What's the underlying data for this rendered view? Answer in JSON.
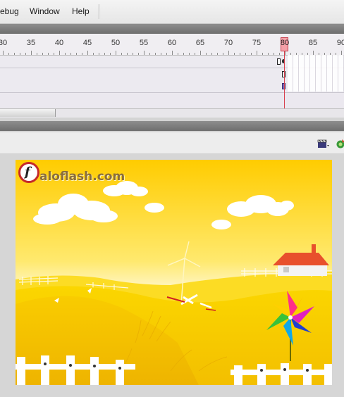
{
  "menubar": {
    "items": [
      "ebug",
      "Window",
      "Help"
    ]
  },
  "timeline": {
    "ruler_labels": [
      "30",
      "35",
      "40",
      "45",
      "50",
      "55",
      "60",
      "65",
      "70",
      "75",
      "80",
      "85",
      "90"
    ],
    "current_frame": "80"
  },
  "stage": {
    "watermark": "aloflash.com",
    "watermark_letter": "f"
  },
  "icons": {
    "edit_scene": "clapperboard-icon",
    "edit_symbol": "symbol-icon"
  },
  "colors": {
    "sky_top": "#ffcc00",
    "grass": "#f7c800",
    "roof": "#e8502c",
    "playhead": "#d8414e"
  }
}
